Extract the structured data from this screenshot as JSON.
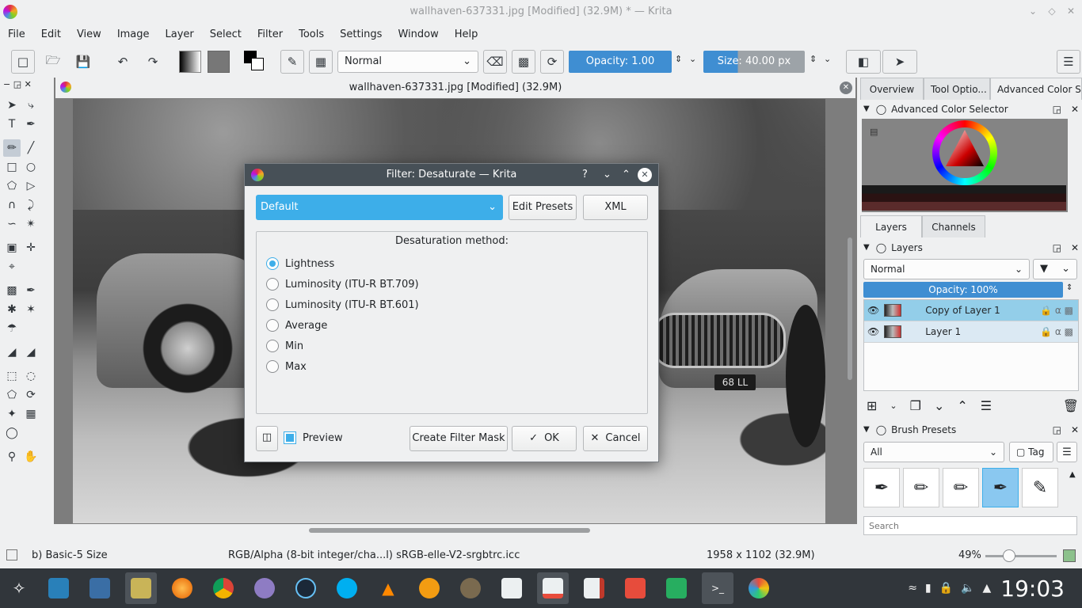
{
  "window": {
    "title": "wallhaven-637331.jpg [Modified] (32.9M) * — Krita",
    "controls": [
      "⌄",
      "◇",
      "✕"
    ]
  },
  "menubar": [
    "File",
    "Edit",
    "View",
    "Image",
    "Layer",
    "Select",
    "Filter",
    "Tools",
    "Settings",
    "Window",
    "Help"
  ],
  "toolbar": {
    "blend_mode": "Normal",
    "opacity_label": "Opacity:  1.00",
    "size_label": "Size:  40.00 px"
  },
  "document": {
    "tab_title": "wallhaven-637331.jpg [Modified]  (32.9M)",
    "plate_text": "68 LL"
  },
  "dialog": {
    "title": "Filter: Desaturate — Krita",
    "title_controls": [
      "?",
      "⌄",
      "⌃",
      "✕"
    ],
    "preset": "Default",
    "edit_presets": "Edit Presets",
    "xml": "XML",
    "group_title": "Desaturation method:",
    "methods": [
      "Lightness",
      "Luminosity (ITU-R BT.709)",
      "Luminosity (ITU-R BT.601)",
      "Average",
      "Min",
      "Max"
    ],
    "selected_method": "Lightness",
    "preview_label": "Preview",
    "preview_checked": true,
    "create_mask": "Create Filter Mask",
    "ok": "OK",
    "cancel": "Cancel"
  },
  "right_panel": {
    "top_tabs": [
      "Overview",
      "Tool Optio...",
      "Advanced Color Se..."
    ],
    "color_selector_title": "Advanced Color Selector",
    "layer_tabs": [
      "Layers",
      "Channels"
    ],
    "layers_title": "Layers",
    "layer_blend": "Normal",
    "layer_opacity": "Opacity:  100%",
    "layers": [
      {
        "name": "Copy of Layer 1",
        "selected": true
      },
      {
        "name": "Layer 1",
        "selected": false
      }
    ],
    "brush_presets_title": "Brush Presets",
    "brush_filter": "All",
    "tag_label": "Tag",
    "search_placeholder": "Search"
  },
  "statusbar": {
    "brush": "b) Basic-5 Size",
    "color_space": "RGB/Alpha (8-bit integer/cha...l)  sRGB-elle-V2-srgbtrc.icc",
    "dimensions": "1958 x 1102 (32.9M)",
    "zoom": "49%"
  },
  "taskbar": {
    "clock": "19:03"
  },
  "colors": {
    "accent": "#3daee9",
    "titlebar_dark": "#475057",
    "taskbar": "#31363b",
    "slider": "#3f8ed2"
  }
}
